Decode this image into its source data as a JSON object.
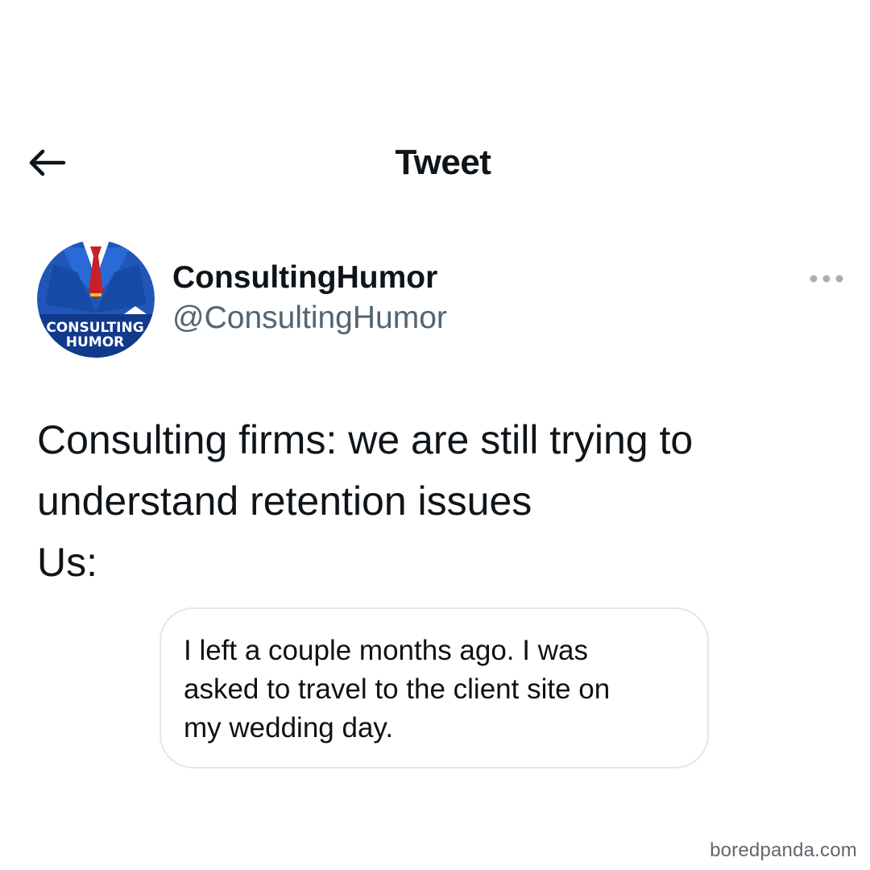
{
  "header": {
    "title": "Tweet",
    "back_icon": "arrow-left-icon"
  },
  "author": {
    "display_name": "ConsultingHumor",
    "handle": "@ConsultingHumor",
    "avatar_text_line1": "CONSULTING",
    "avatar_text_line2": "HUMOR",
    "more_icon": "more-options-icon"
  },
  "tweet": {
    "lines": [
      "Consulting firms: we are still trying to",
      "understand retention issues",
      "Us:"
    ]
  },
  "quote": {
    "lines": [
      "I left a couple months ago. I was",
      "asked to travel to the client site on",
      "my wedding day."
    ]
  },
  "watermark": "boredpanda.com",
  "colors": {
    "avatar_blue": "#1f56b8",
    "avatar_dark_blue": "#123a8c",
    "tie_red": "#c8202a",
    "handle_gray": "#536471"
  }
}
